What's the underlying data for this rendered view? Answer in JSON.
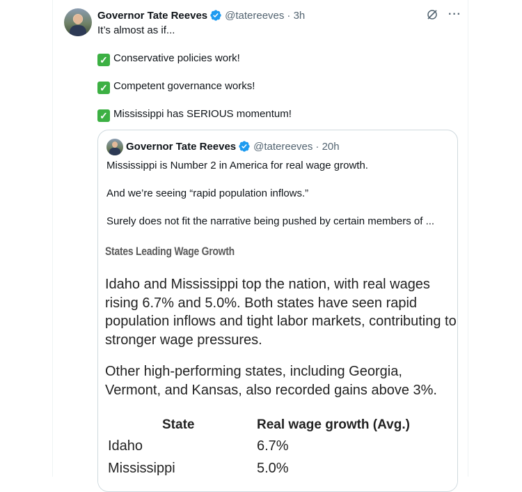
{
  "post": {
    "author_name": "Governor Tate Reeves",
    "handle": "@tatereeves",
    "time": "· 3h",
    "line1": "It’s almost as if...",
    "bullets": [
      "Conservative policies work!",
      "Competent governance works!",
      "Mississippi has SERIOUS momentum!"
    ],
    "check_glyph": "✓"
  },
  "quoted": {
    "author_name": "Governor Tate Reeves",
    "handle": "@tatereeves",
    "time": "· 20h",
    "lines": [
      "Mississippi is Number 2 in America for real wage growth.",
      "And we’re seeing “rapid population inflows.”",
      "Surely does not fit the narrative being pushed by certain members of ..."
    ],
    "image": {
      "title": "States Leading Wage Growth",
      "para1": "Idaho and Mississippi top the nation, with real wages rising 6.7% and 5.0%. Both states have seen rapid population inflows and tight labor markets, contributing to stronger wage pressures.",
      "para2": "Other high-performing states, including Georgia, Vermont, and Kansas, also recorded gains above 3%.",
      "table": {
        "headers": [
          "State",
          "Real wage growth (Avg.)"
        ],
        "rows": [
          [
            "Idaho",
            "6.7%"
          ],
          [
            "Mississippi",
            "5.0%"
          ]
        ]
      }
    }
  },
  "icons": {
    "verified": "verified-badge-icon",
    "grok": "grok-icon",
    "more": "more-options-icon",
    "more_glyph": "···"
  },
  "colors": {
    "verified_blue": "#1d9bf0",
    "check_green": "#3cb043",
    "muted": "#536471"
  }
}
